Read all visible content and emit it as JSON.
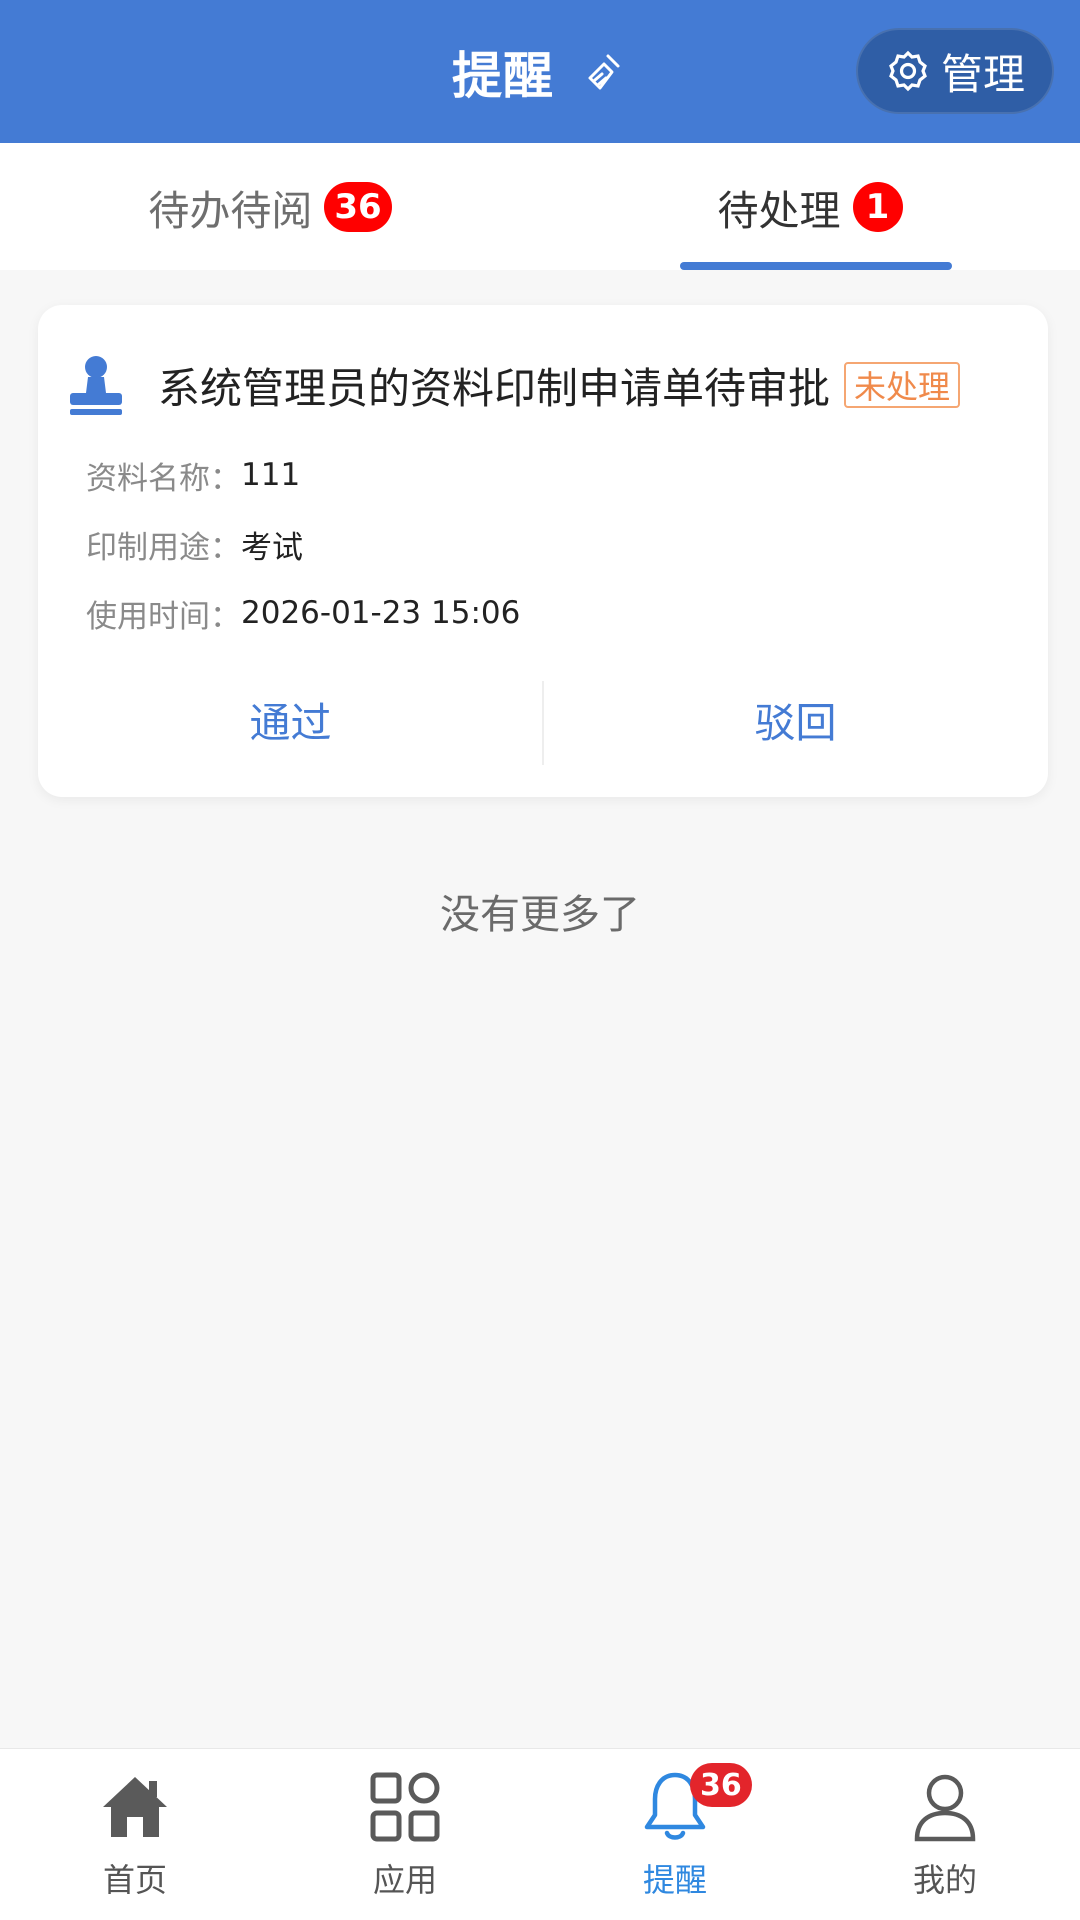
{
  "header": {
    "title": "提醒",
    "manage_label": "管理"
  },
  "tabs": [
    {
      "label": "待办待阅",
      "badge": "36",
      "active": false
    },
    {
      "label": "待处理",
      "badge": "1",
      "active": true
    }
  ],
  "card": {
    "title": "系统管理员的资料印制申请单待审批",
    "status": "未处理",
    "fields": [
      {
        "label": "资料名称：",
        "value": "111"
      },
      {
        "label": "印制用途：",
        "value": "考试"
      },
      {
        "label": "使用时间：",
        "value": "2026-01-23 15:06"
      }
    ],
    "approve_label": "通过",
    "reject_label": "驳回"
  },
  "list_end_text": "没有更多了",
  "bottom_nav": {
    "items": [
      {
        "label": "首页",
        "icon": "home-icon"
      },
      {
        "label": "应用",
        "icon": "apps-grid-icon"
      },
      {
        "label": "提醒",
        "icon": "bell-icon",
        "badge": "36",
        "active": true
      },
      {
        "label": "我的",
        "icon": "user-icon"
      }
    ]
  },
  "colors": {
    "primary": "#447bd4",
    "badge_red": "#ff0000",
    "status_orange": "#f08a4b",
    "active_nav": "#2f88e0"
  }
}
